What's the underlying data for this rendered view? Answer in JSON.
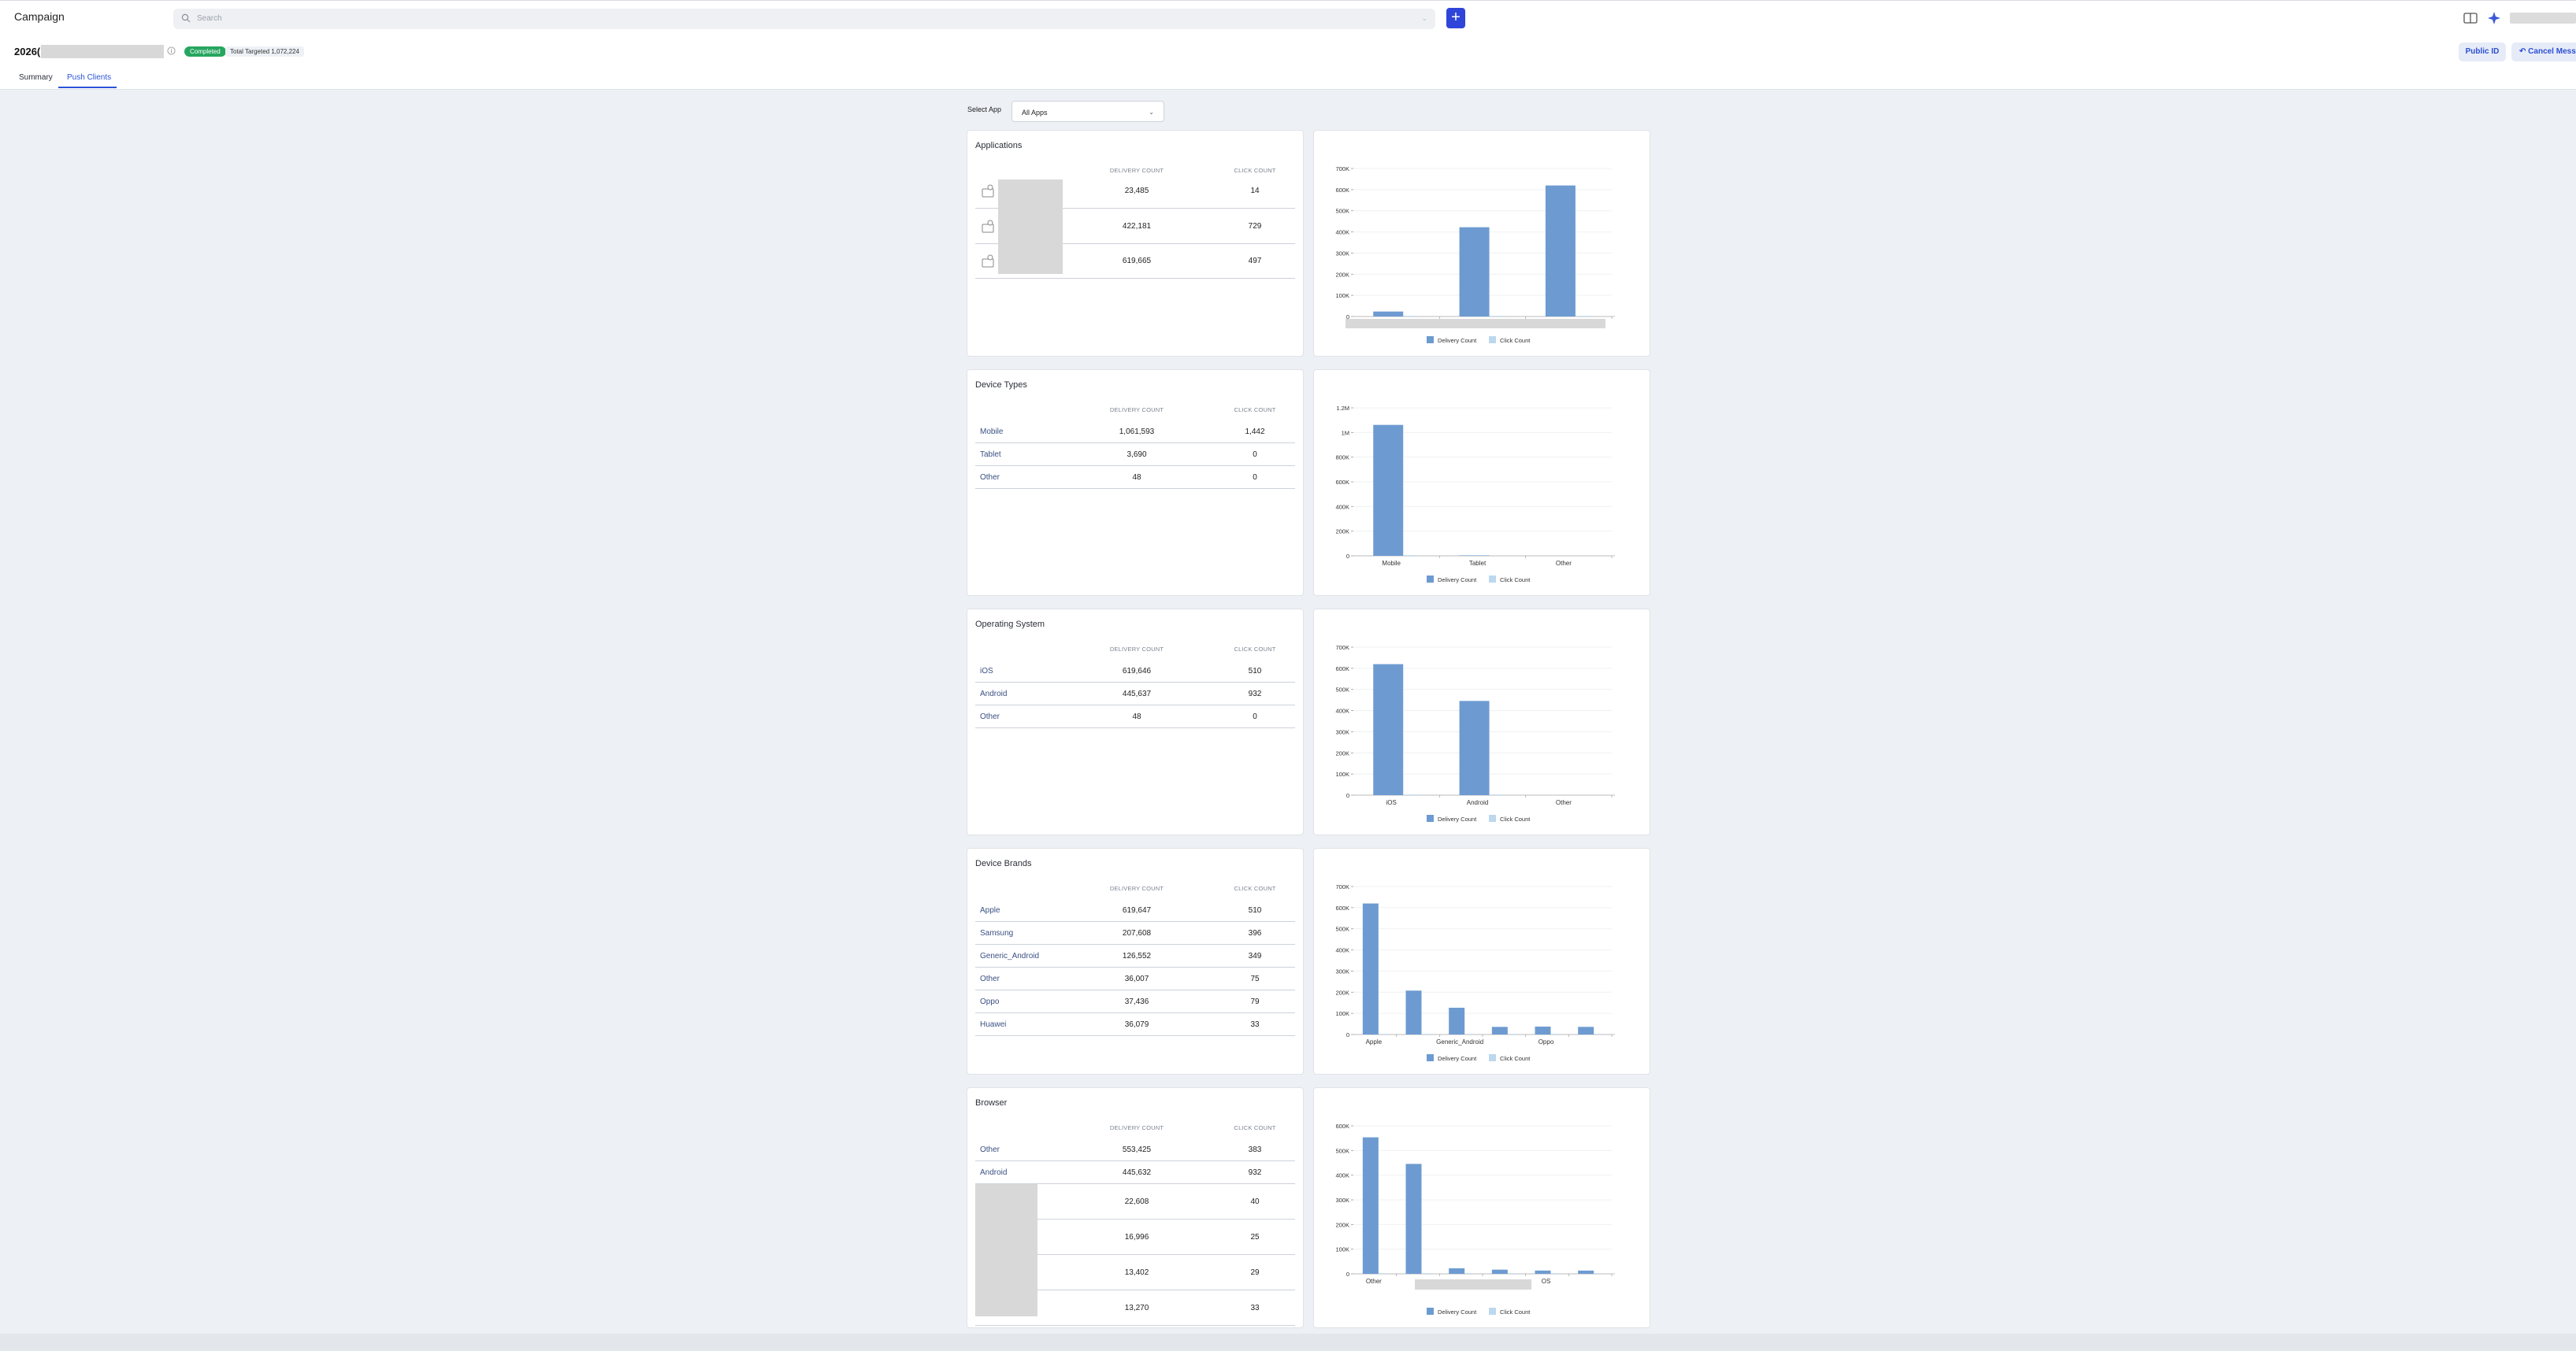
{
  "topbar": {
    "title": "Campaign",
    "search_placeholder": "Search",
    "add_label": "+",
    "icons": [
      "book-icon",
      "sparkle-icon"
    ]
  },
  "campaign": {
    "name_prefix": "2026(",
    "status": "Completed",
    "targeted_label": "Total Targeted",
    "targeted_value": "1,072,224",
    "public_id_label": "Public ID",
    "cancel_label": "Cancel Mess"
  },
  "tabs": [
    {
      "label": "Summary",
      "active": false
    },
    {
      "label": "Push Clients",
      "active": true
    }
  ],
  "select_app": {
    "label": "Select App",
    "value": "All Apps"
  },
  "columns": {
    "delivery": "DELIVERY COUNT",
    "click": "CLICK COUNT"
  },
  "legend": {
    "delivery": "Delivery Count",
    "click": "Click Count"
  },
  "colors": {
    "delivery": "#6d9bd1",
    "click": "#bcd8ee",
    "accent": "#2b54d9",
    "completed": "#26a65f"
  },
  "sections": [
    {
      "title": "Applications",
      "rows": [
        {
          "label": "",
          "delivery": "23,485",
          "click": "14"
        },
        {
          "label": "",
          "delivery": "422,181",
          "click": "729"
        },
        {
          "label": "",
          "delivery": "619,665",
          "click": "497"
        }
      ]
    },
    {
      "title": "Device Types",
      "rows": [
        {
          "label": "Mobile",
          "delivery": "1,061,593",
          "click": "1,442"
        },
        {
          "label": "Tablet",
          "delivery": "3,690",
          "click": "0"
        },
        {
          "label": "Other",
          "delivery": "48",
          "click": "0"
        }
      ]
    },
    {
      "title": "Operating System",
      "rows": [
        {
          "label": "iOS",
          "delivery": "619,646",
          "click": "510"
        },
        {
          "label": "Android",
          "delivery": "445,637",
          "click": "932"
        },
        {
          "label": "Other",
          "delivery": "48",
          "click": "0"
        }
      ]
    },
    {
      "title": "Device Brands",
      "rows": [
        {
          "label": "Apple",
          "delivery": "619,647",
          "click": "510"
        },
        {
          "label": "Samsung",
          "delivery": "207,608",
          "click": "396"
        },
        {
          "label": "Generic_Android",
          "delivery": "126,552",
          "click": "349"
        },
        {
          "label": "Other",
          "delivery": "36,007",
          "click": "75"
        },
        {
          "label": "Oppo",
          "delivery": "37,436",
          "click": "79"
        },
        {
          "label": "Huawei",
          "delivery": "36,079",
          "click": "33"
        }
      ]
    },
    {
      "title": "Browser",
      "rows": [
        {
          "label": "Other",
          "delivery": "553,425",
          "click": "383"
        },
        {
          "label": "Android",
          "delivery": "445,632",
          "click": "932"
        },
        {
          "label": "",
          "delivery": "22,608",
          "click": "40"
        },
        {
          "label": "",
          "delivery": "16,996",
          "click": "25"
        },
        {
          "label": "",
          "delivery": "13,402",
          "click": "29"
        },
        {
          "label": "",
          "delivery": "13,270",
          "click": "33"
        }
      ]
    }
  ],
  "chart_data": [
    {
      "type": "bar",
      "categories": [
        "",
        "",
        ""
      ],
      "series": [
        {
          "name": "Delivery Count",
          "values": [
            23485,
            422181,
            619665
          ]
        },
        {
          "name": "Click Count",
          "values": [
            14,
            729,
            497
          ]
        }
      ],
      "yticks": [
        "0",
        "100K",
        "200K",
        "300K",
        "400K",
        "500K",
        "600K",
        "700K"
      ],
      "ylim": [
        0,
        700000
      ]
    },
    {
      "type": "bar",
      "categories": [
        "Mobile",
        "Tablet",
        "Other"
      ],
      "series": [
        {
          "name": "Delivery Count",
          "values": [
            1061593,
            3690,
            48
          ]
        },
        {
          "name": "Click Count",
          "values": [
            1442,
            0,
            0
          ]
        }
      ],
      "yticks": [
        "0",
        "200K",
        "400K",
        "600K",
        "800K",
        "1M",
        "1.2M"
      ],
      "ylim": [
        0,
        1200000
      ]
    },
    {
      "type": "bar",
      "categories": [
        "iOS",
        "Android",
        "Other"
      ],
      "series": [
        {
          "name": "Delivery Count",
          "values": [
            619646,
            445637,
            48
          ]
        },
        {
          "name": "Click Count",
          "values": [
            510,
            932,
            0
          ]
        }
      ],
      "yticks": [
        "0",
        "100K",
        "200K",
        "300K",
        "400K",
        "500K",
        "600K",
        "700K"
      ],
      "ylim": [
        0,
        700000
      ]
    },
    {
      "type": "bar",
      "categories": [
        "Apple",
        "Samsung",
        "Generic_Android",
        "Other",
        "Oppo",
        "Huawei"
      ],
      "xlabels_shown": [
        "Apple",
        "",
        "Generic_Android",
        "",
        "Oppo",
        ""
      ],
      "series": [
        {
          "name": "Delivery Count",
          "values": [
            619647,
            207608,
            126552,
            36007,
            37436,
            36079
          ]
        },
        {
          "name": "Click Count",
          "values": [
            510,
            396,
            349,
            75,
            79,
            33
          ]
        }
      ],
      "yticks": [
        "0",
        "100K",
        "200K",
        "300K",
        "400K",
        "500K",
        "600K",
        "700K"
      ],
      "ylim": [
        0,
        700000
      ]
    },
    {
      "type": "bar",
      "categories": [
        "Other",
        "Android",
        "",
        "",
        "",
        ""
      ],
      "xlabels_shown": [
        "Other",
        "",
        "",
        "",
        "OS",
        ""
      ],
      "series": [
        {
          "name": "Delivery Count",
          "values": [
            553425,
            445632,
            22608,
            16996,
            13402,
            13270
          ]
        },
        {
          "name": "Click Count",
          "values": [
            383,
            932,
            40,
            25,
            29,
            33
          ]
        }
      ],
      "yticks": [
        "0",
        "100K",
        "200K",
        "300K",
        "400K",
        "500K",
        "600K"
      ],
      "ylim": [
        0,
        600000
      ]
    }
  ]
}
